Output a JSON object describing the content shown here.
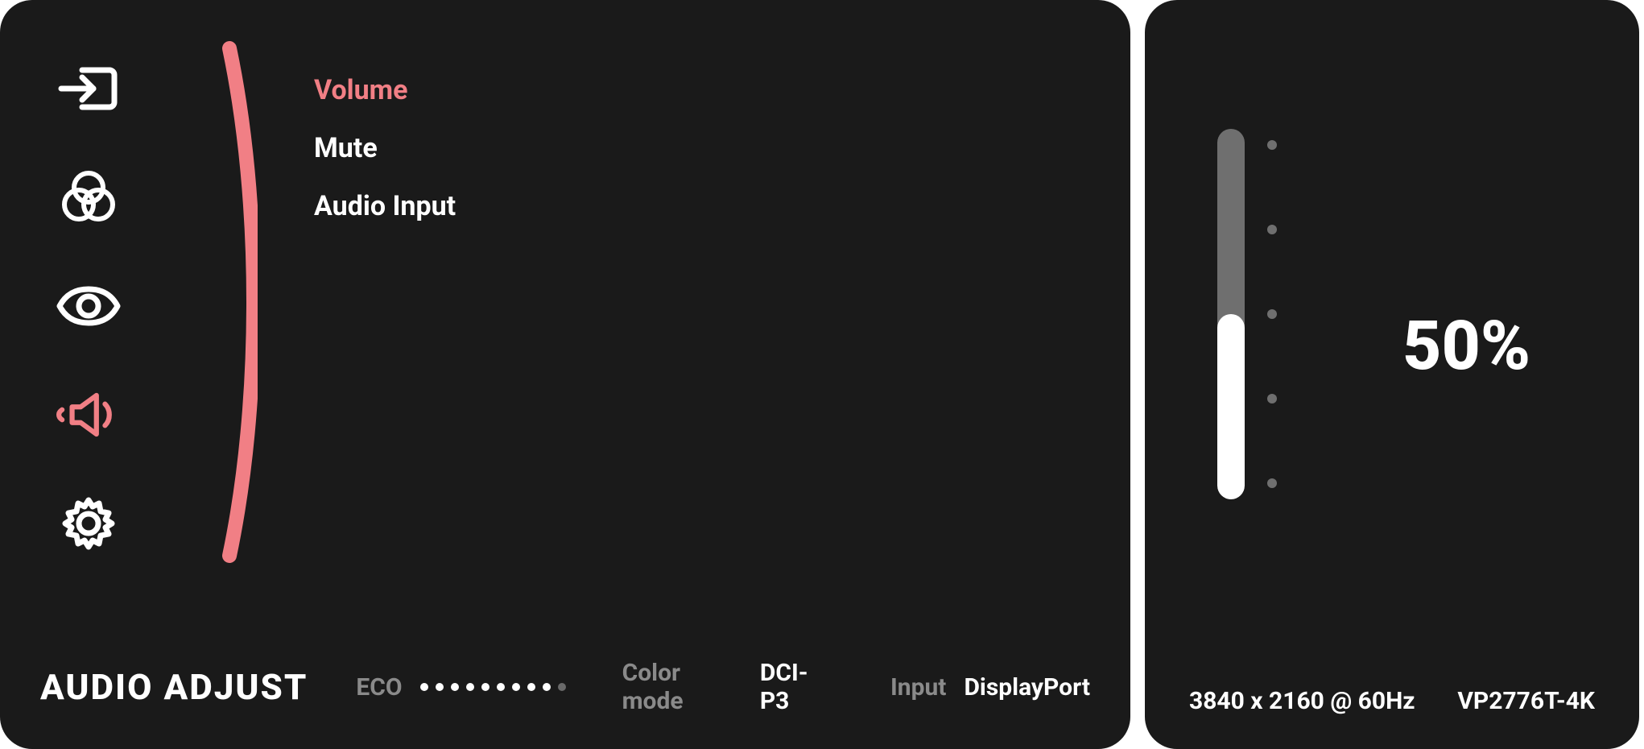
{
  "accent": "#f17f85",
  "sidebar": {
    "active_index": 3,
    "items": [
      {
        "name": "input-select-icon"
      },
      {
        "name": "color-icon"
      },
      {
        "name": "view-mode-icon"
      },
      {
        "name": "audio-icon"
      },
      {
        "name": "settings-icon"
      }
    ]
  },
  "menu": {
    "active_index": 0,
    "items": [
      {
        "label": "Volume"
      },
      {
        "label": "Mute"
      },
      {
        "label": "Audio Input"
      }
    ]
  },
  "footer": {
    "title": "AUDIO ADJUST",
    "eco_label": "ECO",
    "eco_dots_total": 10,
    "eco_dots_active": 9,
    "color_mode_label": "Color mode",
    "color_mode_value": "DCI-P3",
    "input_label": "Input",
    "input_value": "DisplayPort"
  },
  "slider": {
    "percent": 50,
    "percent_text": "50%"
  },
  "side_footer": {
    "resolution": "3840 x 2160 @ 60Hz",
    "model": "VP2776T-4K"
  }
}
